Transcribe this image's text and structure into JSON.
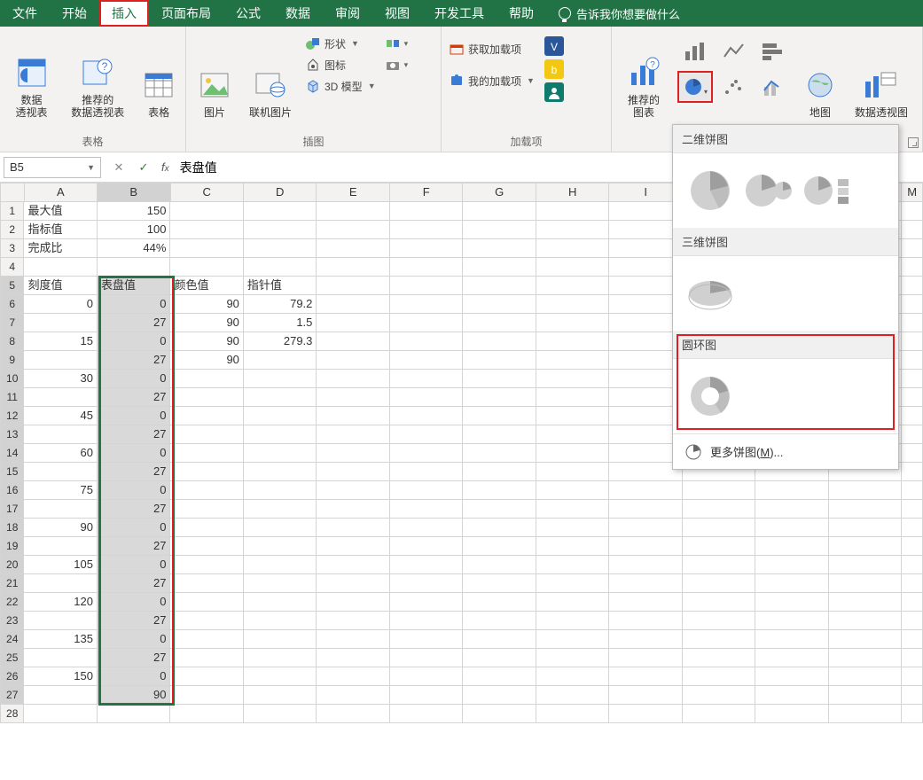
{
  "menu": {
    "items": [
      "文件",
      "开始",
      "插入",
      "页面布局",
      "公式",
      "数据",
      "审阅",
      "视图",
      "开发工具",
      "帮助"
    ],
    "active_index": 2,
    "tell_me": "告诉我你想要做什么"
  },
  "ribbon": {
    "group_tables": {
      "label": "表格",
      "pivot": "数据\n透视表",
      "recommended_pivot": "推荐的\n数据透视表",
      "table": "表格"
    },
    "group_illustrations": {
      "label": "插图",
      "picture": "图片",
      "online_picture": "联机图片",
      "shapes": "形状",
      "icons": "图标",
      "model3d": "3D 模型"
    },
    "group_addins": {
      "label": "加载项",
      "get_addins": "获取加载项",
      "my_addins": "我的加载项"
    },
    "group_charts": {
      "recommended": "推荐的\n图表",
      "map": "地图",
      "pivot_chart": "数据透视图"
    }
  },
  "formula_bar": {
    "name_box": "B5",
    "value": "表盘值"
  },
  "columns": [
    "A",
    "B",
    "C",
    "D",
    "E",
    "F",
    "G",
    "H",
    "I",
    "J",
    "K",
    "L",
    "M"
  ],
  "rows": [
    {
      "n": 1,
      "A": "最大值",
      "B": "150"
    },
    {
      "n": 2,
      "A": "指标值",
      "B": "100"
    },
    {
      "n": 3,
      "A": "完成比",
      "B": "44%"
    },
    {
      "n": 4
    },
    {
      "n": 5,
      "A": "刻度值",
      "B": "表盘值",
      "C": "颜色值",
      "D": "指针值"
    },
    {
      "n": 6,
      "A": "0",
      "B": "0",
      "C": "90",
      "D": "79.2"
    },
    {
      "n": 7,
      "B": "27",
      "C": "90",
      "D": "1.5"
    },
    {
      "n": 8,
      "A": "15",
      "B": "0",
      "C": "90",
      "D": "279.3"
    },
    {
      "n": 9,
      "B": "27",
      "C": "90"
    },
    {
      "n": 10,
      "A": "30",
      "B": "0"
    },
    {
      "n": 11,
      "B": "27"
    },
    {
      "n": 12,
      "A": "45",
      "B": "0"
    },
    {
      "n": 13,
      "B": "27"
    },
    {
      "n": 14,
      "A": "60",
      "B": "0"
    },
    {
      "n": 15,
      "B": "27"
    },
    {
      "n": 16,
      "A": "75",
      "B": "0"
    },
    {
      "n": 17,
      "B": "27"
    },
    {
      "n": 18,
      "A": "90",
      "B": "0"
    },
    {
      "n": 19,
      "B": "27"
    },
    {
      "n": 20,
      "A": "105",
      "B": "0"
    },
    {
      "n": 21,
      "B": "27"
    },
    {
      "n": 22,
      "A": "120",
      "B": "0"
    },
    {
      "n": 23,
      "B": "27"
    },
    {
      "n": 24,
      "A": "135",
      "B": "0"
    },
    {
      "n": 25,
      "B": "27"
    },
    {
      "n": 26,
      "A": "150",
      "B": "0"
    },
    {
      "n": 27,
      "B": "90"
    },
    {
      "n": 28
    }
  ],
  "selection": {
    "col": "B",
    "row_start": 5,
    "row_end": 27
  },
  "pie_panel": {
    "sec2d": "二维饼图",
    "sec3d": "三维饼图",
    "donut": "圆环图",
    "more_pre": "更多饼图(",
    "more_key": "M",
    "more_post": ")..."
  }
}
